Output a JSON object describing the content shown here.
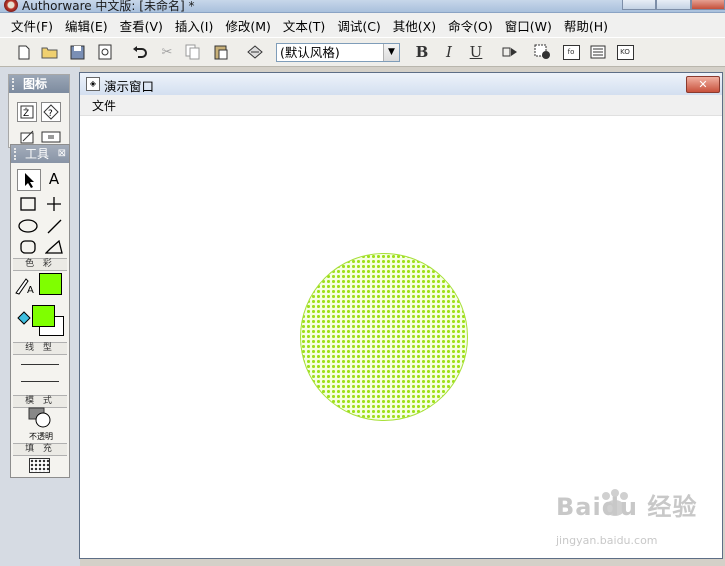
{
  "window": {
    "title": "Authorware 中文版: [未命名] *"
  },
  "menubar": {
    "items": [
      "文件(F)",
      "编辑(E)",
      "查看(V)",
      "插入(I)",
      "修改(M)",
      "文本(T)",
      "调试(C)",
      "其他(X)",
      "命令(O)",
      "窗口(W)",
      "帮助(H)"
    ]
  },
  "toolbar": {
    "style_select": "(默认风格)",
    "bold": "B",
    "italic": "I",
    "underline": "U",
    "fo_label": "fo",
    "ko_label": "KO"
  },
  "icons_panel": {
    "title": "图标"
  },
  "tools_panel": {
    "title": "工具",
    "color_label": "色 彩",
    "line_label": "线 型",
    "mode_label": "模 式",
    "mode_value": "不透明",
    "fill_label": "填 充"
  },
  "colors": {
    "fill_foreground": "#7fff00",
    "pen_color": "#7fff00",
    "circle_fill": "#9fe01a"
  },
  "presentation": {
    "title": "演示窗口",
    "menu_file": "文件"
  },
  "watermark": {
    "brand": "Baidu 经验",
    "url": "jingyan.baidu.com"
  }
}
